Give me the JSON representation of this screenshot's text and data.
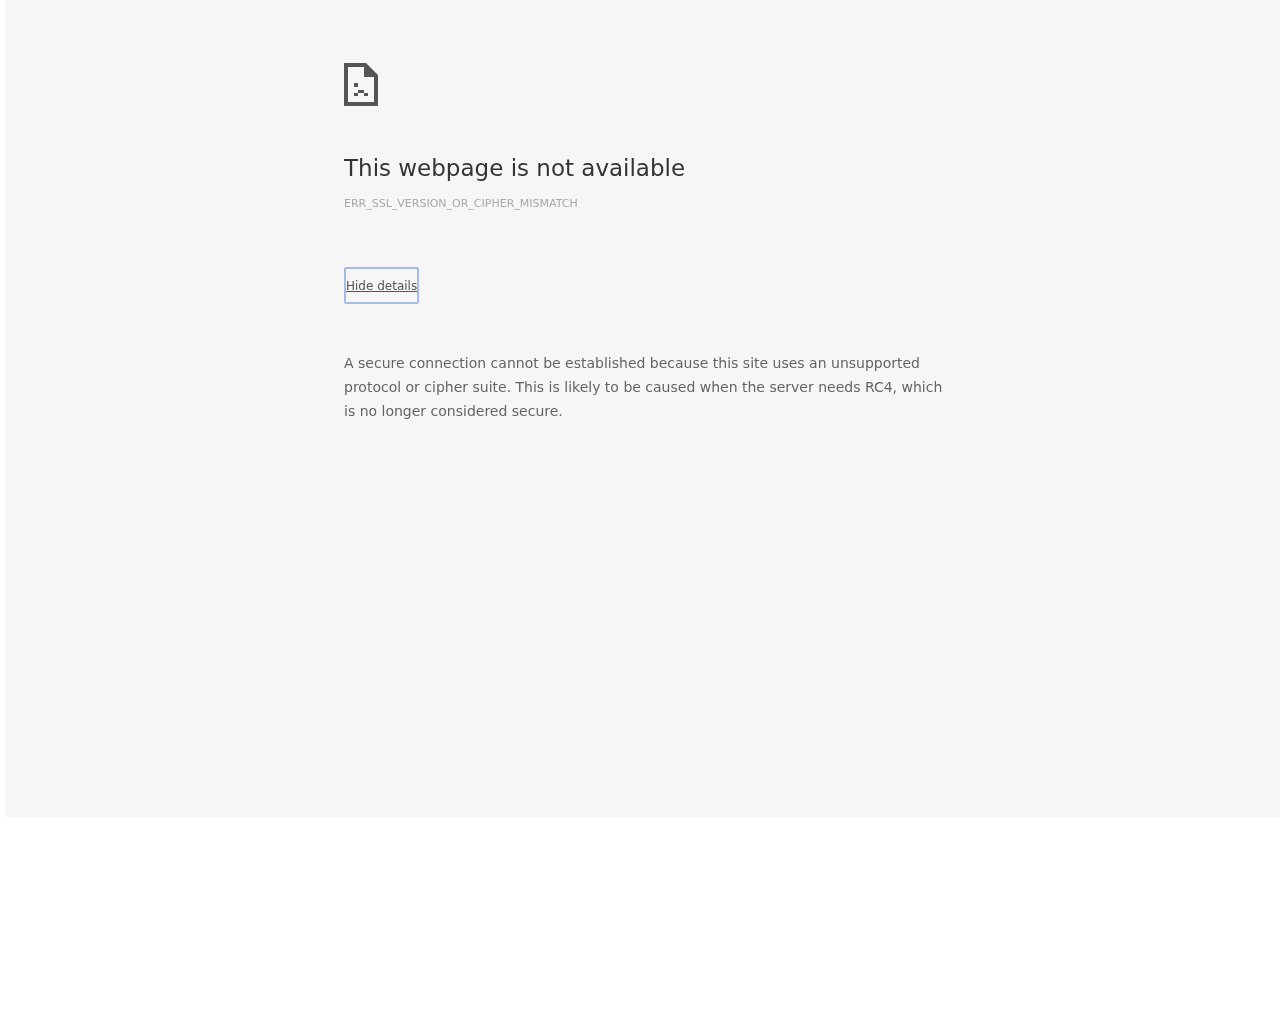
{
  "error_page": {
    "heading": "This webpage is not available",
    "error_code": "ERR_SSL_VERSION_OR_CIPHER_MISMATCH",
    "details_button": {
      "label": "Hide details",
      "focused": true
    },
    "details_text": "A secure connection cannot be established because this site uses an unsupported protocol or cipher suite. This is likely to be caused when the server needs RC4, which is no longer considered secure."
  }
}
